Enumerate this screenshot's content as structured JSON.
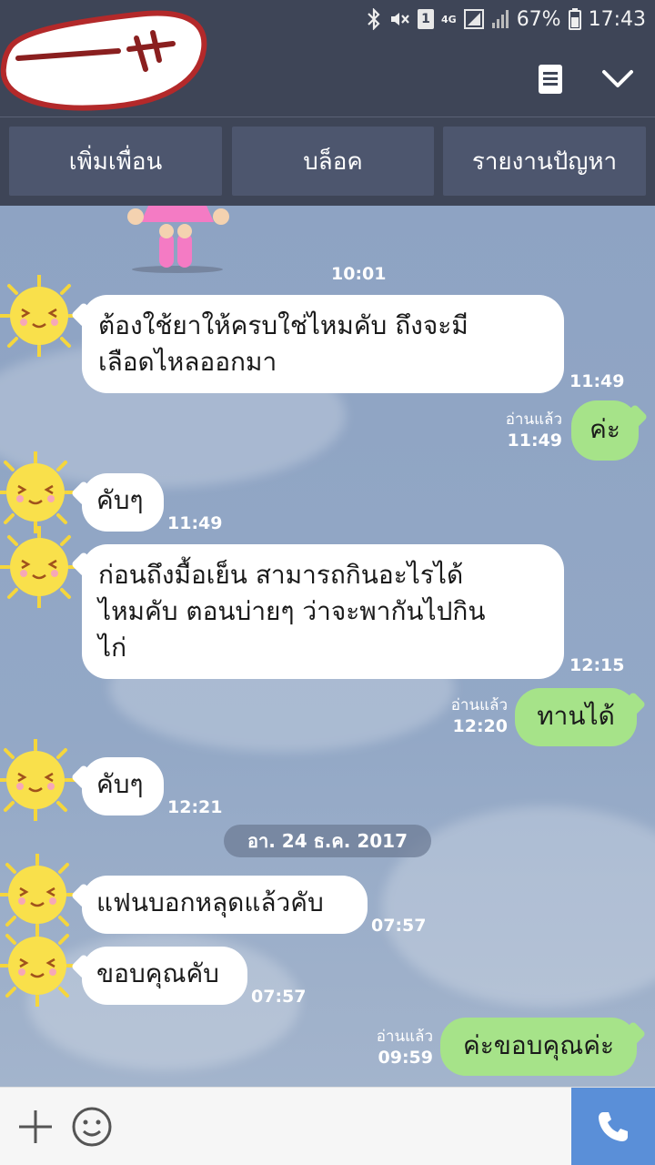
{
  "status_bar": {
    "network": "4G",
    "sim": "1",
    "battery": "67%",
    "time": "17:43"
  },
  "header": {
    "menu_icon": "list-icon",
    "collapse_icon": "chevron-down-icon"
  },
  "actions": {
    "add_friend": "เพิ่มเพื่อน",
    "block": "บล็อค",
    "report": "รายงานปัญหา"
  },
  "chat": {
    "first_time": "10:01",
    "date_separator": "อา. 24 ธ.ค. 2017",
    "read_label": "อ่านแล้ว",
    "messages": [
      {
        "from": "them",
        "lines": [
          "ต้องใช้ยาให้ครบใช่ไหมคับ ถึงจะมี",
          "เลือดไหลออกมา"
        ],
        "time": "11:49"
      },
      {
        "from": "me",
        "text": "ค่ะ",
        "time": "11:49"
      },
      {
        "from": "them",
        "text": "คับๆ",
        "time": "11:49"
      },
      {
        "from": "them",
        "lines": [
          "ก่อนถึงมื้อเย็น สามารถกินอะไรได้",
          "ไหมคับ ตอนบ่ายๆ ว่าจะพากันไปกิน",
          "ไก่"
        ],
        "time": "12:15"
      },
      {
        "from": "me",
        "text": "ทานได้",
        "time": "12:20"
      },
      {
        "from": "them",
        "text": "คับๆ",
        "time": "12:21"
      },
      {
        "from": "them",
        "text": "แฟนบอกหลุดแล้วคับ",
        "time": "07:57"
      },
      {
        "from": "them",
        "text": "ขอบคุณคับ",
        "time": "07:57"
      },
      {
        "from": "me",
        "text": "ค่ะขอบคุณค่ะ",
        "time": "09:59"
      }
    ]
  },
  "input_bar": {
    "add_icon": "plus-icon",
    "sticker_icon": "emoji-icon",
    "call_icon": "phone-icon"
  },
  "colors": {
    "header_bg": "#3e4557",
    "button_bg": "#4d566e",
    "outgoing_bubble": "#a6e389",
    "incoming_bubble": "#ffffff",
    "call_button": "#5a8fd8"
  }
}
